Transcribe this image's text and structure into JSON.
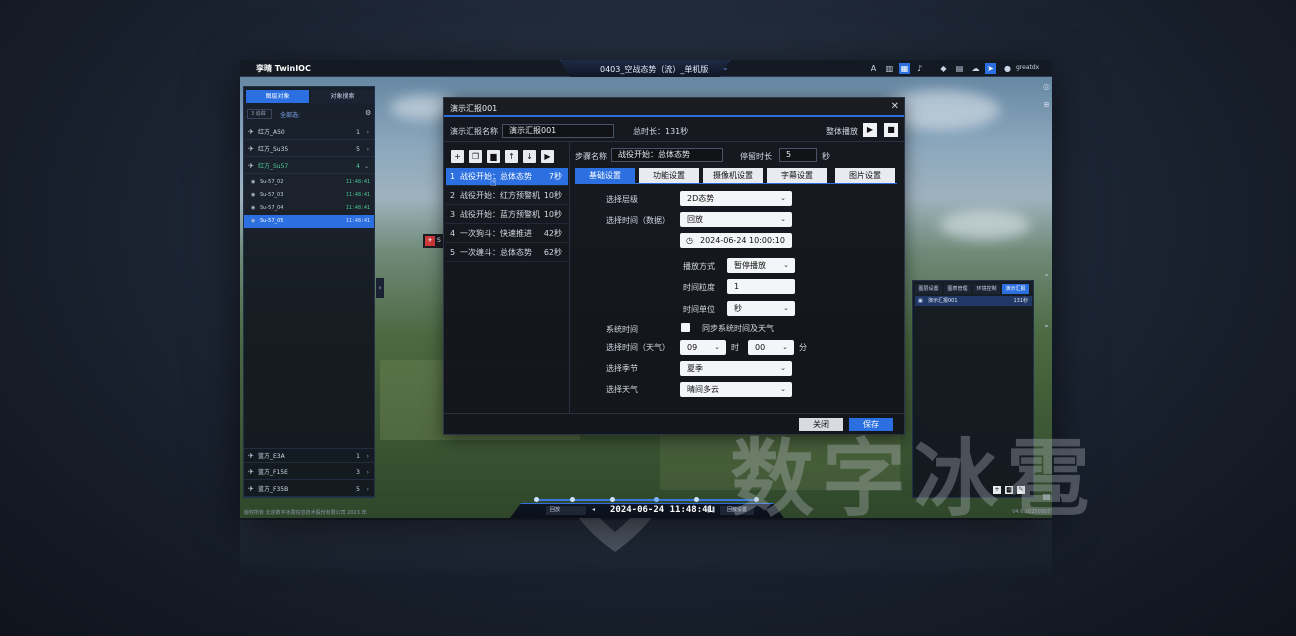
{
  "app": {
    "logo_text": "孪晴 TwinIOC",
    "title": "0403_空战态势（流）_单机版",
    "user": "greatdx",
    "copyright": "版权所有 北京数字冰雹信息技术股份有限公司 2023 年",
    "version": "V4.6.20250507"
  },
  "left_panel": {
    "tabs": [
      "图层对象",
      "对象搜索"
    ],
    "filter_box": "3  追踪",
    "filter_selected": "全部选:",
    "groups": [
      {
        "name": "红方_A50",
        "count": "1"
      },
      {
        "name": "红方_Su35",
        "count": "5"
      },
      {
        "name": "红方_Su57",
        "count": "4"
      }
    ],
    "subitems": [
      {
        "name": "Su-57_02",
        "time": "11:48:41"
      },
      {
        "name": "Su-57_03",
        "time": "11:48:41"
      },
      {
        "name": "Su-57_04",
        "time": "11:48:41"
      },
      {
        "name": "Su-57_05",
        "time": "11:48:41"
      }
    ],
    "bottom_groups": [
      {
        "name": "蓝方_E3A",
        "count": "1"
      },
      {
        "name": "蓝方_F15E",
        "count": "3"
      },
      {
        "name": "蓝方_F35B",
        "count": "5"
      }
    ]
  },
  "target_label": "S",
  "dialog": {
    "title": "演示汇报001",
    "name_label": "演示汇报名称",
    "name_value": "演示汇报001",
    "total_label": "总时长：131秒",
    "play_all_label": "整体播放",
    "steps": [
      {
        "n": "1",
        "name": "战役开始：总体态势",
        "dur": "7秒"
      },
      {
        "n": "2",
        "name": "战役开始：红方预警机",
        "dur": "10秒"
      },
      {
        "n": "3",
        "name": "战役开始：蓝方预警机",
        "dur": "10秒"
      },
      {
        "n": "4",
        "name": "一次狗斗：快速推进",
        "dur": "42秒"
      },
      {
        "n": "5",
        "name": "一次缠斗：总体态势",
        "dur": "62秒"
      }
    ],
    "step_name_label": "步骤名称",
    "step_name_value": "战役开始：总体态势",
    "stay_label": "停留时长",
    "stay_value": "5",
    "stay_unit": "秒",
    "tabs": [
      "基础设置",
      "功能设置",
      "摄像机设置",
      "字幕设置",
      "图片设置"
    ],
    "form": {
      "layer_label": "选择层级",
      "layer_value": "2D态势",
      "time_label": "选择时间（数据）",
      "time_value": "回放",
      "date_value": "2024-06-24 10:00:10",
      "play_mode_label": "播放方式",
      "play_mode_value": "暂停播放",
      "granularity_label": "时间粒度",
      "granularity_value": "1",
      "unit_label": "时间单位",
      "unit_value": "秒",
      "system_time_label": "系统时间",
      "sync_label": "同步系统时间及天气",
      "weather_time_label": "选择时间（天气）",
      "hour_value": "09",
      "hour_unit": "时",
      "minute_value": "00",
      "minute_unit": "分",
      "season_label": "选择季节",
      "season_value": "夏季",
      "weather_label": "选择天气",
      "weather_value": "晴间多云"
    },
    "close_label": "关闭",
    "save_label": "保存"
  },
  "right_panel": {
    "tabs": [
      "图层设置",
      "图表管理",
      "环境控制",
      "演示汇报"
    ],
    "item_name": "演示汇报001",
    "item_dur": "131秒"
  },
  "timeline": {
    "mode": "回放",
    "time": "2024-06-24 11:48:41",
    "settings_label": "回放设置"
  },
  "watermark": "数字冰雹",
  "colors": {
    "accent": "#2c6fe0",
    "success": "#4fc89a",
    "alert": "#d23a3a"
  },
  "icons": [
    "plus-icon",
    "copy-icon",
    "delete-icon",
    "arrow-up-icon",
    "arrow-down-icon",
    "play-icon",
    "stop-icon",
    "close-icon",
    "calendar-icon",
    "gear-icon",
    "user-icon",
    "cursor-icon"
  ]
}
